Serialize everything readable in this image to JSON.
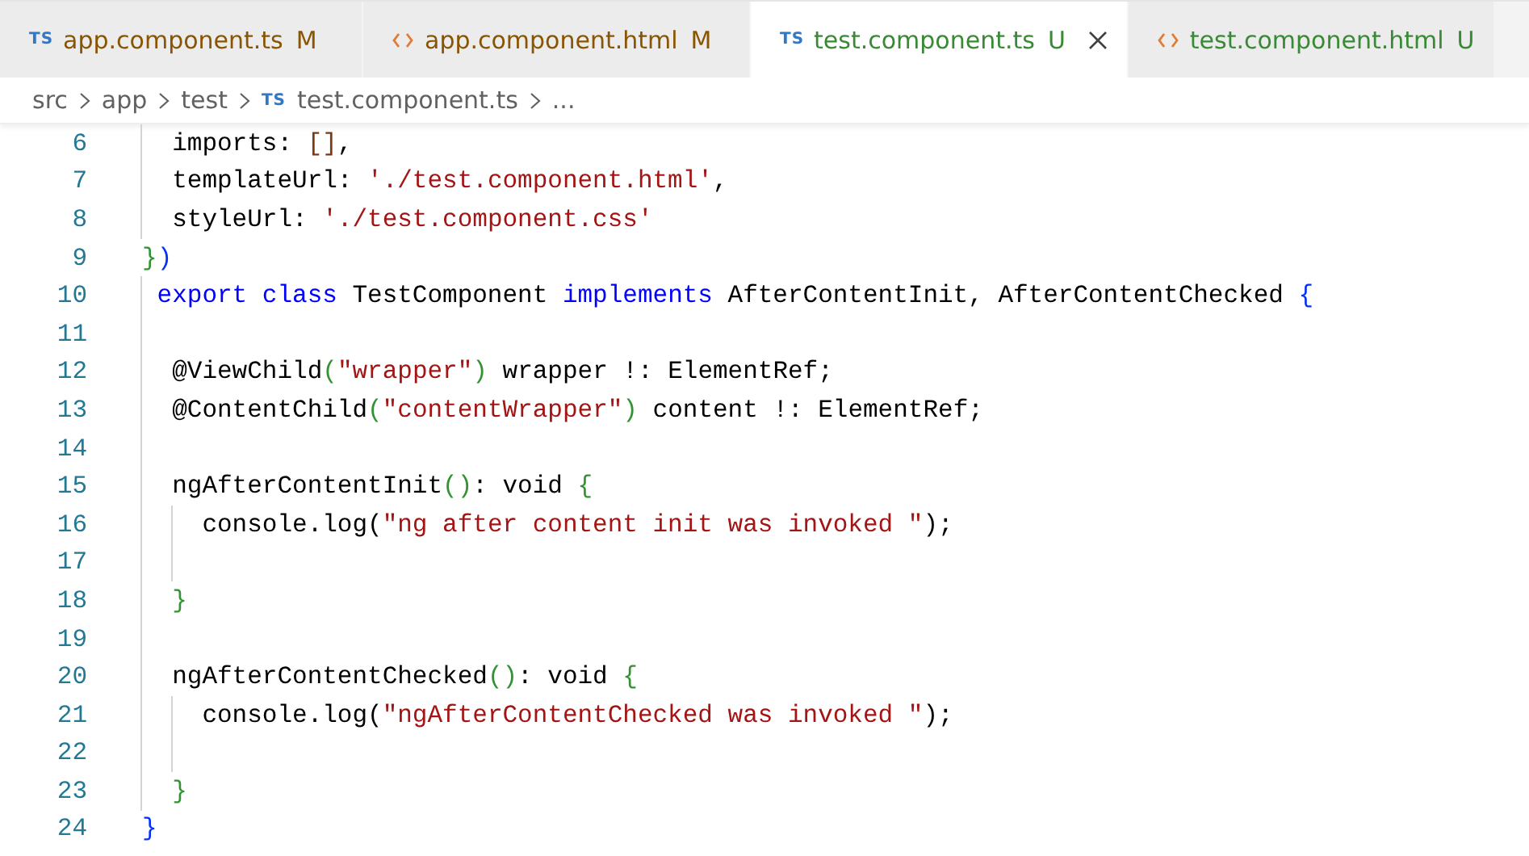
{
  "tabs": [
    {
      "kind": "ts",
      "icon_text": "TS",
      "label": "app.component.ts",
      "status": "M",
      "color": "#895503",
      "selected": false
    },
    {
      "kind": "html",
      "label": "app.component.html",
      "status": "M",
      "color": "#895503",
      "selected": false
    },
    {
      "kind": "ts",
      "icon_text": "TS",
      "label": "test.component.ts",
      "status": "U",
      "color": "#388a34",
      "selected": true
    },
    {
      "kind": "html",
      "label": "test.component.html",
      "status": "U",
      "color": "#388a34",
      "selected": false
    }
  ],
  "breadcrumb": [
    {
      "label": "src"
    },
    {
      "label": "app"
    },
    {
      "label": "test"
    },
    {
      "icon_text": "TS",
      "label": "test.component.ts"
    },
    {
      "label": "..."
    }
  ],
  "editor": {
    "lines": [
      {
        "number": "6",
        "tokens": [
          {
            "t": "  imports: ",
            "kind": "plain"
          },
          {
            "t": "[]",
            "kind": "bracket3"
          },
          {
            "t": ",",
            "kind": "plain"
          }
        ]
      },
      {
        "number": "7",
        "tokens": [
          {
            "t": "  templateUrl: ",
            "kind": "plain"
          },
          {
            "t": "'./test.component.html'",
            "kind": "string"
          },
          {
            "t": ",",
            "kind": "plain"
          }
        ]
      },
      {
        "number": "8",
        "tokens": [
          {
            "t": "  styleUrl: ",
            "kind": "plain"
          },
          {
            "t": "'./test.component.css'",
            "kind": "string"
          }
        ]
      },
      {
        "number": "9",
        "tokens": [
          {
            "t": "}",
            "kind": "bracket2"
          },
          {
            "t": ")",
            "kind": "bracket1"
          }
        ]
      },
      {
        "number": "10",
        "tokens": [
          {
            "t": " export class",
            "kind": "keyword"
          },
          {
            "t": " TestComponent ",
            "kind": "plain"
          },
          {
            "t": "implements",
            "kind": "keyword"
          },
          {
            "t": " AfterContentInit, AfterContentChecked ",
            "kind": "plain"
          },
          {
            "t": "{",
            "kind": "bracket1"
          }
        ]
      },
      {
        "number": "11"
      },
      {
        "number": "12",
        "tokens": [
          {
            "t": "  @ViewChild",
            "kind": "plain"
          },
          {
            "t": "(",
            "kind": "bracket2"
          },
          {
            "t": "\"wrapper\"",
            "kind": "string"
          },
          {
            "t": ")",
            "kind": "bracket2"
          },
          {
            "t": " wrapper !: ElementRef;",
            "kind": "plain"
          }
        ]
      },
      {
        "number": "13",
        "tokens": [
          {
            "t": "  @ContentChild",
            "kind": "plain"
          },
          {
            "t": "(",
            "kind": "bracket2"
          },
          {
            "t": "\"contentWrapper\"",
            "kind": "string"
          },
          {
            "t": ")",
            "kind": "bracket2"
          },
          {
            "t": " content !: ElementRef;",
            "kind": "plain"
          }
        ]
      },
      {
        "number": "14"
      },
      {
        "number": "15",
        "tokens": [
          {
            "t": "  ngAfterContentInit",
            "kind": "plain"
          },
          {
            "t": "()",
            "kind": "bracket2"
          },
          {
            "t": ": void ",
            "kind": "plain"
          },
          {
            "t": "{",
            "kind": "bracket2"
          }
        ]
      },
      {
        "number": "16",
        "tokens": [
          {
            "t": "    console.log(",
            "kind": "plain"
          },
          {
            "t": "\"ng after content init was invoked \"",
            "kind": "string"
          },
          {
            "t": ");",
            "kind": "plain"
          }
        ]
      },
      {
        "number": "17"
      },
      {
        "number": "18",
        "tokens": [
          {
            "t": "  }",
            "kind": "bracket2"
          }
        ]
      },
      {
        "number": "19"
      },
      {
        "number": "20",
        "tokens": [
          {
            "t": "  ngAfterContentChecked",
            "kind": "plain"
          },
          {
            "t": "()",
            "kind": "bracket2"
          },
          {
            "t": ": void ",
            "kind": "plain"
          },
          {
            "t": "{",
            "kind": "bracket2"
          }
        ]
      },
      {
        "number": "21",
        "tokens": [
          {
            "t": "    console.log(",
            "kind": "plain"
          },
          {
            "t": "\"ngAfterContentChecked was invoked \"",
            "kind": "string"
          },
          {
            "t": ");",
            "kind": "plain"
          }
        ]
      },
      {
        "number": "22"
      },
      {
        "number": "23",
        "tokens": [
          {
            "t": "  }",
            "kind": "bracket2"
          }
        ]
      },
      {
        "number": "24",
        "tokens": [
          {
            "t": "}",
            "kind": "bracket1"
          }
        ]
      }
    ]
  }
}
